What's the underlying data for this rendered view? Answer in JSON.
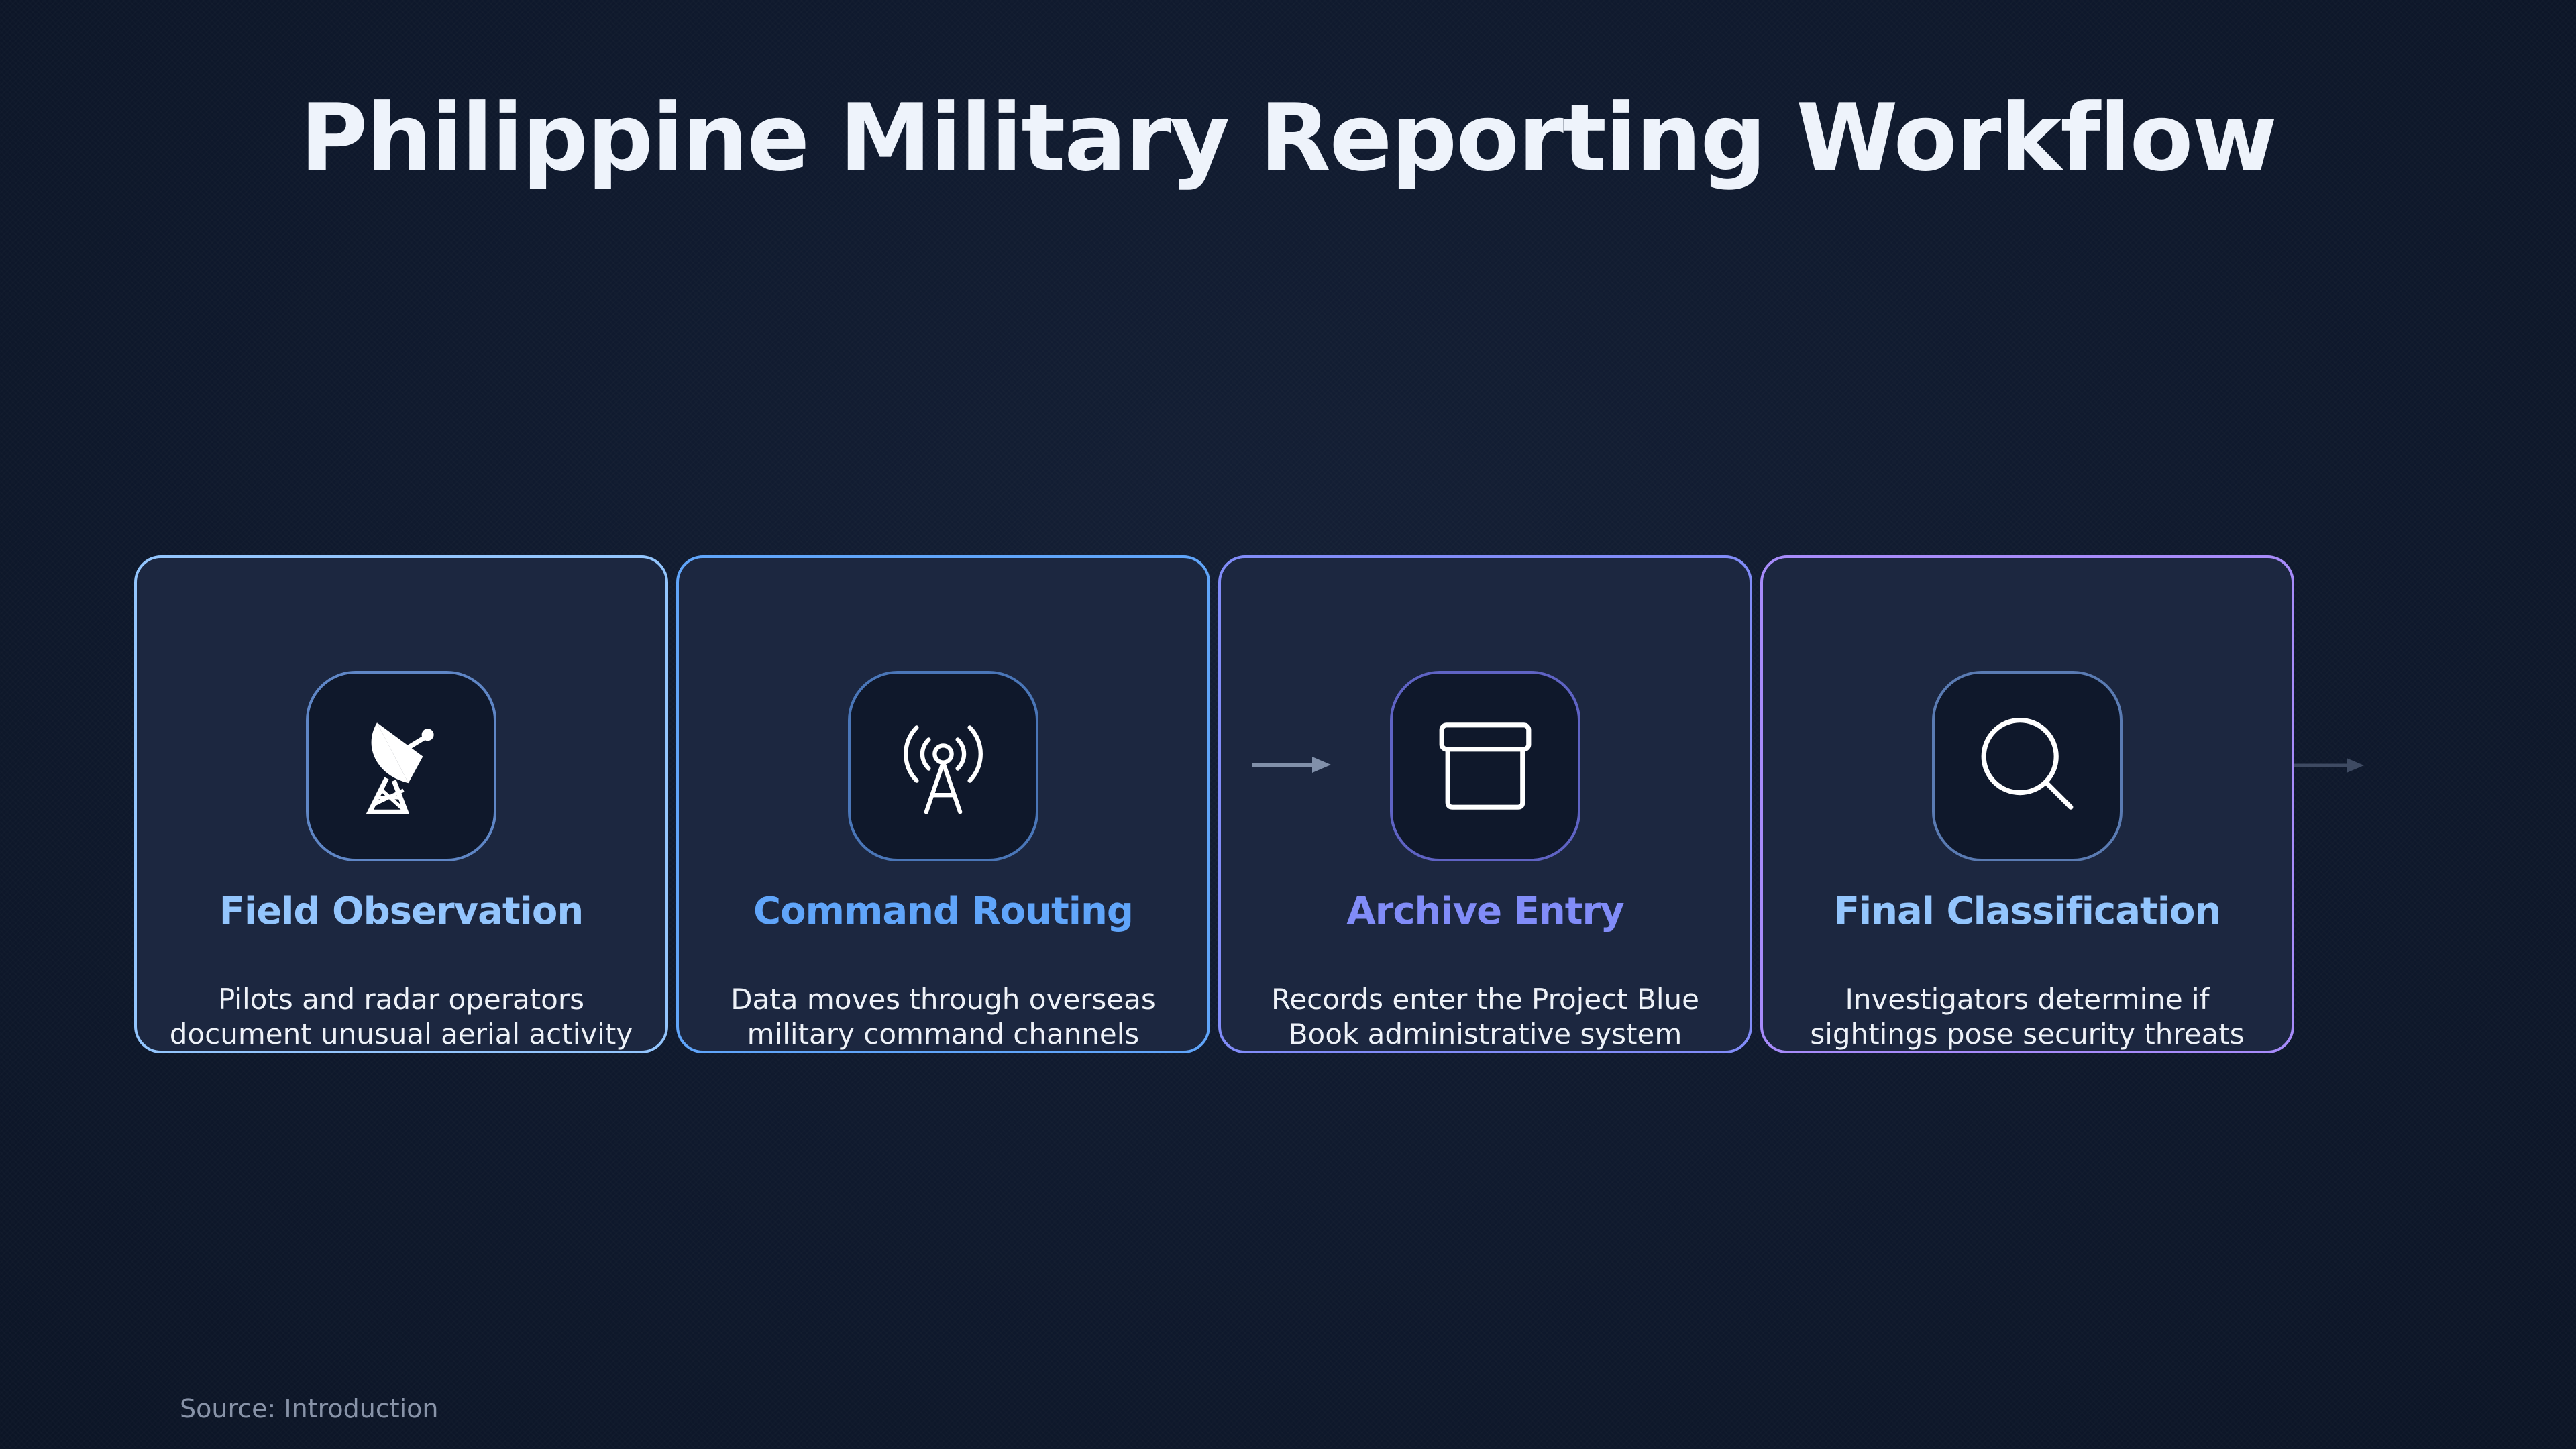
{
  "title": "Philippine Military Reporting Workflow",
  "steps": [
    {
      "title": "Field Observation",
      "description": "Pilots and radar operators document unusual aerial activity",
      "icon": "satellite-dish-icon",
      "accent": "#93c5fd"
    },
    {
      "title": "Command Routing",
      "description": "Data moves through overseas military command channels",
      "icon": "radio-tower-icon",
      "accent": "#60a5fa"
    },
    {
      "title": "Archive Entry",
      "description": "Records enter the Project Blue Book administrative system",
      "icon": "archive-box-icon",
      "accent": "#818cf8"
    },
    {
      "title": "Final Classification",
      "description": "Investigators determine if sightings pose security threats",
      "icon": "magnifying-glass-icon",
      "accent": "#93c5fd"
    }
  ],
  "colors": {
    "background": "#0f192d",
    "card_background": "#1c2740",
    "card_borders": [
      "#93c5fd",
      "#60a5fa",
      "#818cf8",
      "#a78bfa"
    ]
  },
  "source": "Source: Introduction"
}
